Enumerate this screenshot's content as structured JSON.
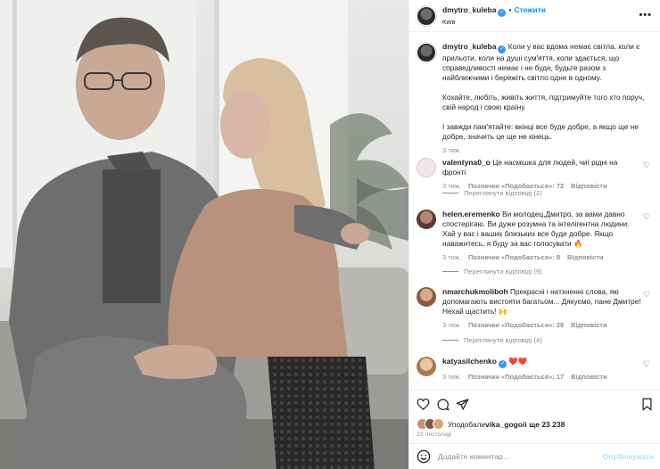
{
  "post": {
    "username": "dmytro_kuleba",
    "follow_label": "Стежити",
    "location": "Київ",
    "more_label": "•••"
  },
  "caption": {
    "username": "dmytro_kuleba",
    "p1": "Коли у вас вдома немає світла, коли є прильоти, коли на душі сум'яття, коли здається, що справедливості немає і не буде, будьте разом з найближчими і бережіть світло одне в одному.",
    "p2": "Кохайте, любіть, живіть життя, підтримуйте того хто поруч, свій народ і свою країну.",
    "p3": "І завжди пам'ятайте: вкінці все буде добре, а якщо ще не добре, значить це ще не кінець.",
    "time": "3 тиж."
  },
  "comments": [
    {
      "username": "valentyna0_o",
      "text": "Це насмішка для людей, чиї рідні на фронті",
      "time": "3 тиж.",
      "likes": "Позначки «Подобається»: 72",
      "reply": "Відповісти",
      "view_replies": "Переглянути відповіді (2)"
    },
    {
      "username": "helen.eremenko",
      "text": "Ви молодец,Дмитро, за вами давно спостерігаю. Ви дуже розумна та інтелігентна людини. Хай у вас і ваших близьких все буде добре. Якщо наважитесь, я буду за вас голосувати 🔥",
      "time": "3 тиж.",
      "likes": "Позначки «Подобається»: 8",
      "reply": "Відповісти",
      "view_replies": "Переглянути відповіді (9)"
    },
    {
      "username": "nmarchukmoliboh",
      "text": "Прекрасні і натхненні слова, які допомагають вистояти багатьом... Дякуємо, пане Дмитре! Нехай щастить! 🙌",
      "time": "3 тиж.",
      "likes": "Позначки «Подобається»: 29",
      "reply": "Відповісти",
      "view_replies": "Переглянути відповіді (4)"
    },
    {
      "username": "katyasilchenko",
      "text": "❤️❤️",
      "time": "3 тиж.",
      "likes": "Позначки «Подобається»: 17",
      "reply": "Відповісти"
    }
  ],
  "footer": {
    "liked_by_prefix": "Уподобали ",
    "liked_by_user": "vika_gogoi",
    "liked_by_suffix": " і ще 23 238",
    "date": "23 листопад",
    "comment_placeholder": "Додайте коментар...",
    "publish_label": "Опублікувати"
  },
  "colors": {
    "accent": "#0095f6",
    "verified": "#3897f0",
    "muted": "#8e8e8e"
  }
}
